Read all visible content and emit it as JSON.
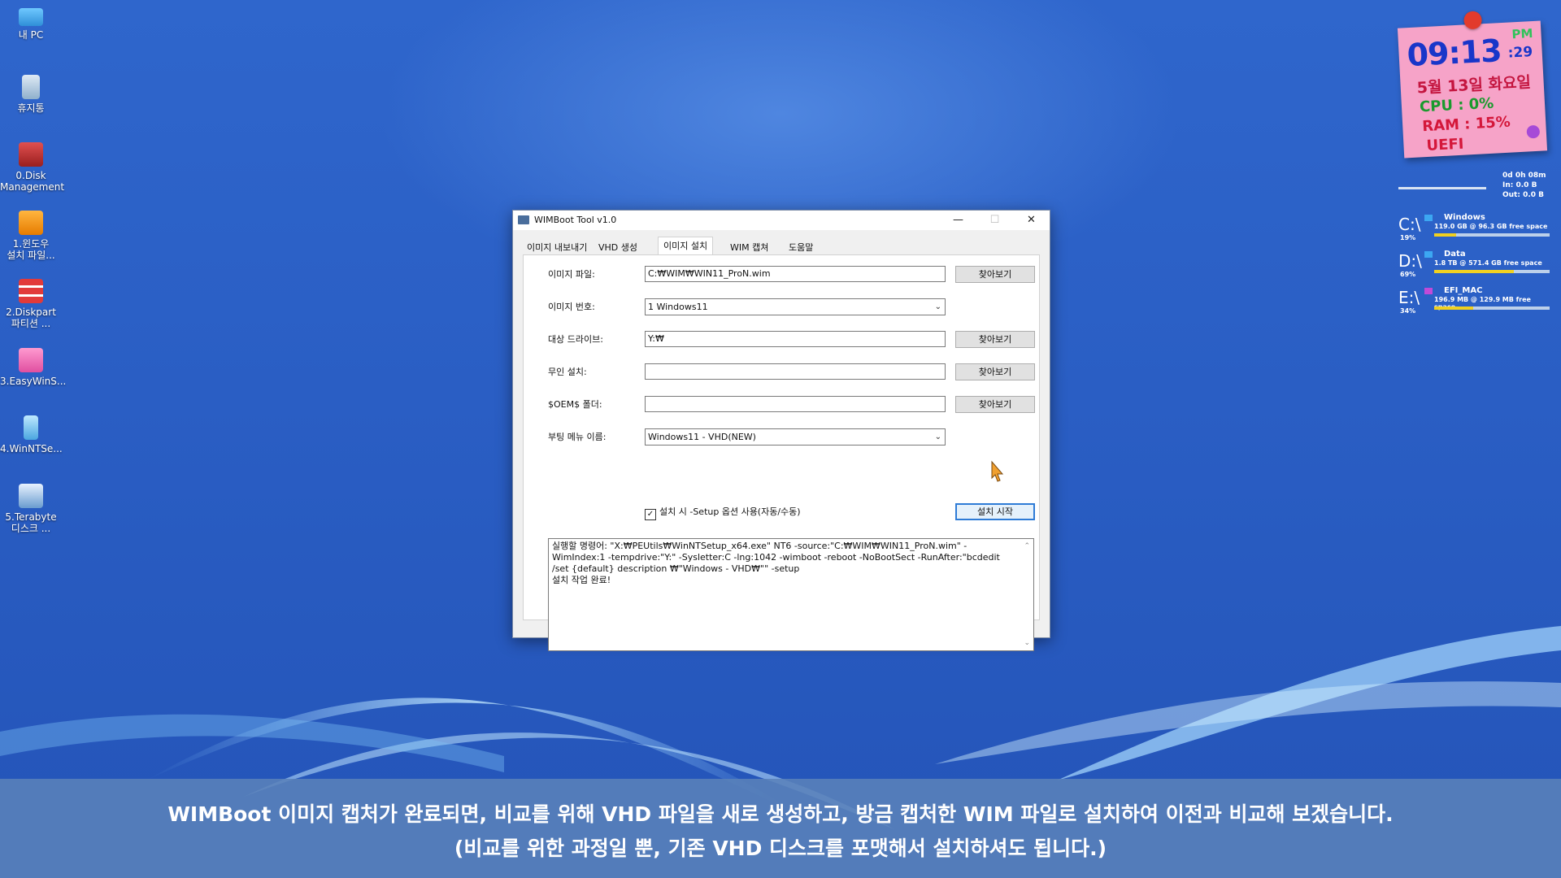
{
  "desktop": {
    "icons": [
      {
        "label_line1": "내 PC",
        "label_line2": "",
        "icon": "monitor-icon"
      },
      {
        "label_line1": "휴지통",
        "label_line2": "",
        "icon": "recycle-bin-icon"
      },
      {
        "label_line1": "0.Disk",
        "label_line2": "Management",
        "icon": "disk-management-icon"
      },
      {
        "label_line1": "1.윈도우",
        "label_line2": "설치 파일...",
        "icon": "windows-setup-icon"
      },
      {
        "label_line1": "2.Diskpart",
        "label_line2": "파티션 ...",
        "icon": "diskpart-icon"
      },
      {
        "label_line1": "3.EasyWinS...",
        "label_line2": "",
        "icon": "easywinsetup-icon"
      },
      {
        "label_line1": "4.WinNTSe...",
        "label_line2": "",
        "icon": "winntsetup-icon"
      },
      {
        "label_line1": "5.Terabyte",
        "label_line2": "디스크 ...",
        "icon": "terabyte-icon"
      }
    ]
  },
  "clock": {
    "time": "09:13",
    "seconds": ":29",
    "ampm": "PM",
    "date": "5월 13일 화요일",
    "cpu": "CPU :  0%",
    "ram": "RAM :  15%",
    "boot": "UEFI"
  },
  "drives_widget": {
    "uptime": "0d 0h 08m",
    "net_in": "In: 0.0 B",
    "net_out": "Out: 0.0 B",
    "drives": [
      {
        "letter": "C:\\",
        "pct": "19%",
        "name": "Windows",
        "info": "119.0 GB @ 96.3 GB free space",
        "fill": 0.19
      },
      {
        "letter": "D:\\",
        "pct": "69%",
        "name": "Data",
        "info": "1.8 TB @      571.4 GB free space",
        "fill": 0.69
      },
      {
        "letter": "E:\\",
        "pct": "34%",
        "name": "EFI_MAC",
        "info": "196.9 MB @ 129.9 MB free space",
        "fill": 0.34
      }
    ]
  },
  "window": {
    "title": "WIMBoot Tool v1.0",
    "minimize": "—",
    "maximize": "☐",
    "close": "✕",
    "tabs": [
      "이미지 내보내기",
      "VHD 생성",
      "이미지 설치",
      "WIM 캡쳐",
      "도움말"
    ],
    "active_tab": "이미지 설치",
    "form": {
      "image_file_label": "이미지 파일:",
      "image_file_value": "C:₩WIM₩WIN11_ProN.wim",
      "image_index_label": "이미지 번호:",
      "image_index_value": "1 Windows11",
      "target_drive_label": "대상 드라이브:",
      "target_drive_value": "Y:₩",
      "unattend_label": "무인 설치:",
      "unattend_value": "",
      "oem_label": "$OEM$ 폴더:",
      "oem_value": "",
      "boot_menu_label": "부팅 메뉴 이름:",
      "boot_menu_value": "Windows11 - VHD(NEW)",
      "browse_label": "찾아보기",
      "setup_option_label": "설치 시 -Setup 옵션 사용(자동/수동)",
      "setup_option_checked": true,
      "start_install_label": "설치 시작"
    },
    "log": "실행할 명령어: \"X:₩PEUtils₩WinNTSetup_x64.exe\" NT6 -source:\"C:₩WIM₩WIN11_ProN.wim\" -WimIndex:1 -tempdrive:\"Y:\" -Sysletter:C -lng:1042 -wimboot -reboot -NoBootSect -RunAfter:\"bcdedit /set {default} description ₩\"Windows - VHD₩\"\" -setup\n설치 작업 완료!"
  },
  "subtitle": {
    "line1": "WIMBoot 이미지 캡처가 완료되면, 비교를 위해 VHD 파일을 새로 생성하고, 방금 캡처한 WIM 파일로 설치하여 이전과 비교해 보겠습니다.",
    "line2": "(비교를 위한 과정일 뿐, 기존 VHD 디스크를 포맷해서 설치하셔도 됩니다.)"
  }
}
